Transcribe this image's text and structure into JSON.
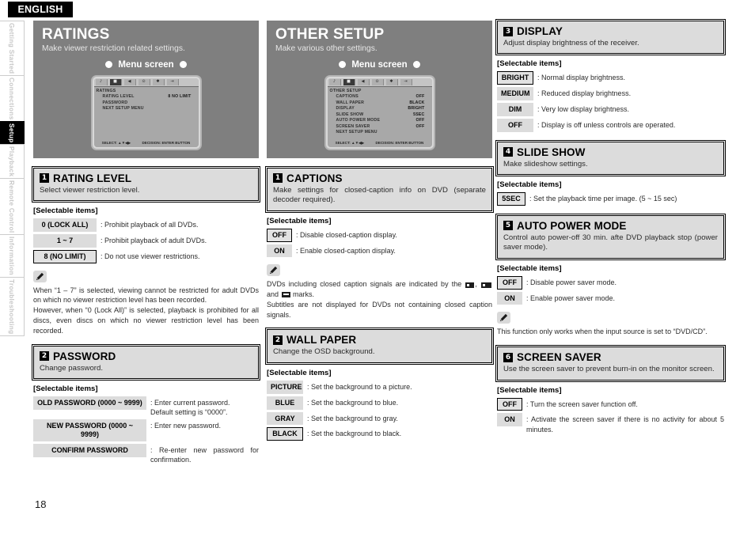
{
  "language_tab": "ENGLISH",
  "page_number": "18",
  "sidebar": {
    "items": [
      {
        "label": "Getting Started",
        "active": false
      },
      {
        "label": "Connections",
        "active": false
      },
      {
        "label": "Setup",
        "active": true
      },
      {
        "label": "Playback",
        "active": false
      },
      {
        "label": "Remote Control",
        "active": false
      },
      {
        "label": "Information",
        "active": false
      },
      {
        "label": "Troubleshooting",
        "active": false
      }
    ]
  },
  "col1": {
    "hero": {
      "title": "RATINGS",
      "subtitle": "Make viewer restriction related settings.",
      "menu_label": "Menu screen"
    },
    "osd": {
      "heading": "RATINGS",
      "rows": [
        {
          "name": "RATING LEVEL",
          "value": "8 NO LIMIT"
        },
        {
          "name": "PASSWORD",
          "value": ""
        },
        {
          "name": "NEXT SETUP MENU",
          "value": ""
        }
      ],
      "footer_left": "SELECT: ▲▼◀▶",
      "footer_right": "DECISION: ENTER BUTTON",
      "tabs": [
        "audio-tab",
        "video-tab",
        "speaker-tab",
        "ratings-tab",
        "other-tab",
        "exit-tab"
      ]
    },
    "sections": [
      {
        "num": "1",
        "title": "RATING LEVEL",
        "desc": "Select viewer restriction level.",
        "selectable_label": "[Selectable items]",
        "options": [
          {
            "key": "0 (LOCK ALL)",
            "desc": ": Prohibit playback of all DVDs.",
            "default": false
          },
          {
            "key": "1 ~ 7",
            "desc": ": Prohibit playback of adult DVDs.",
            "default": false
          },
          {
            "key": "8 (NO LIMIT)",
            "desc": ": Do not use viewer restrictions.",
            "default": true
          }
        ],
        "note": "When “1 – 7” is selected, viewing cannot be restricted for adult DVDs on which no viewer restriction level has been recorded.\nHowever, when “0 (Lock All)” is selected, playback is prohibited for all discs, even discs on which no viewer restriction level has been recorded."
      },
      {
        "num": "2",
        "title": "PASSWORD",
        "desc": "Change password.",
        "selectable_label": "[Selectable items]",
        "options": [
          {
            "key": "OLD PASSWORD (0000 ~ 9999)",
            "desc": ": Enter current password.\nDefault setting is “0000”.",
            "default": false
          },
          {
            "key": "NEW PASSWORD (0000 ~ 9999)",
            "desc": ": Enter new password.",
            "default": false
          },
          {
            "key": "CONFIRM PASSWORD",
            "desc": ": Re-enter new password for confirmation.",
            "default": false
          }
        ]
      }
    ]
  },
  "col2": {
    "hero": {
      "title": "OTHER SETUP",
      "subtitle": "Make various other settings.",
      "menu_label": "Menu screen"
    },
    "osd": {
      "heading": "OTHER SETUP",
      "rows": [
        {
          "name": "CAPTIONS",
          "value": "OFF"
        },
        {
          "name": "WALL PAPER",
          "value": "BLACK"
        },
        {
          "name": "DISPLAY",
          "value": "BRIGHT"
        },
        {
          "name": "SLIDE SHOW",
          "value": "5SEC"
        },
        {
          "name": "AUTO POWER MODE",
          "value": "OFF"
        },
        {
          "name": "SCREEN SAVER",
          "value": "OFF"
        },
        {
          "name": "NEXT SETUP MENU",
          "value": ""
        }
      ],
      "footer_left": "SELECT: ▲▼◀▶",
      "footer_right": "DECISION: ENTER BUTTON",
      "tabs": [
        "audio-tab",
        "video-tab",
        "speaker-tab",
        "ratings-tab",
        "other-tab",
        "exit-tab"
      ]
    },
    "sections": [
      {
        "num": "1",
        "title": "CAPTIONS",
        "desc": "Make settings for closed-caption info on DVD (separate decoder required).",
        "selectable_label": "[Selectable items]",
        "options": [
          {
            "key": "OFF",
            "desc": ": Disable closed-caption display.",
            "default": true
          },
          {
            "key": "ON",
            "desc": ": Enable closed-caption display.",
            "default": false
          }
        ],
        "note_pre": "DVDs including closed caption signals are indicated by the",
        "note_mid": ",",
        "note_and": "and",
        "note_post": "marks.",
        "note_tail": "Subtitles are not displayed for DVDs not containing closed caption signals."
      },
      {
        "num": "2",
        "title": "WALL PAPER",
        "desc": "Change the OSD background.",
        "selectable_label": "[Selectable items]",
        "options": [
          {
            "key": "PICTURE",
            "desc": ": Set the background to a picture.",
            "default": false
          },
          {
            "key": "BLUE",
            "desc": ": Set the background to blue.",
            "default": false
          },
          {
            "key": "GRAY",
            "desc": ": Set the background to gray.",
            "default": false
          },
          {
            "key": "BLACK",
            "desc": ": Set the background to black.",
            "default": true
          }
        ]
      }
    ]
  },
  "col3": {
    "sections": [
      {
        "num": "3",
        "title": "DISPLAY",
        "desc": "Adjust display brightness of the receiver.",
        "selectable_label": "[Selectable items]",
        "options": [
          {
            "key": "BRIGHT",
            "desc": ": Normal display brightness.",
            "default": true
          },
          {
            "key": "MEDIUM",
            "desc": ": Reduced display brightness.",
            "default": false
          },
          {
            "key": "DIM",
            "desc": ": Very low display brightness.",
            "default": false
          },
          {
            "key": "OFF",
            "desc": ": Display is off unless controls are operated.",
            "default": false
          }
        ]
      },
      {
        "num": "4",
        "title": "SLIDE SHOW",
        "desc": "Make slideshow settings.",
        "selectable_label": "[Selectable items]",
        "options": [
          {
            "key": "5SEC",
            "desc": ": Set the playback time per image. (5 ~ 15 sec)",
            "default": true
          }
        ]
      },
      {
        "num": "5",
        "title": "AUTO POWER MODE",
        "desc": "Control auto power-off 30 min. afte DVD playback stop (power saver mode).",
        "selectable_label": "[Selectable items]",
        "options": [
          {
            "key": "OFF",
            "desc": ": Disable power saver mode.",
            "default": true
          },
          {
            "key": "ON",
            "desc": ": Enable power saver mode.",
            "default": false
          }
        ],
        "note": "This function only works when the input source is set to “DVD/CD”."
      },
      {
        "num": "6",
        "title": "SCREEN SAVER",
        "desc": "Use the screen saver to prevent burn-in on the monitor screen.",
        "selectable_label": "[Selectable items]",
        "options": [
          {
            "key": "OFF",
            "desc": ": Turn the screen saver function off.",
            "default": true
          },
          {
            "key": "ON",
            "desc": ": Activate the screen saver if there is no activity for about 5 minutes.",
            "default": false
          }
        ]
      }
    ]
  },
  "colors": {
    "hero_bg": "#7f7f7f",
    "section_bg": "#dcdcdc",
    "active_tab_bg": "#000000",
    "text": "#1a1a1a"
  }
}
